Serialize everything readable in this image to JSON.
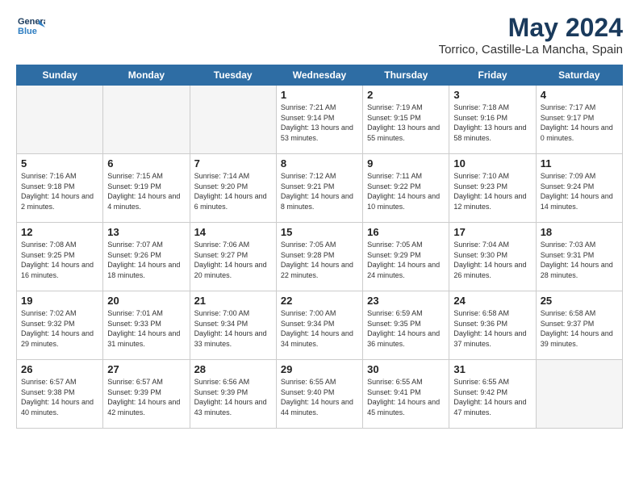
{
  "header": {
    "logo_line1": "General",
    "logo_line2": "Blue",
    "month": "May 2024",
    "location": "Torrico, Castille-La Mancha, Spain"
  },
  "weekdays": [
    "Sunday",
    "Monday",
    "Tuesday",
    "Wednesday",
    "Thursday",
    "Friday",
    "Saturday"
  ],
  "weeks": [
    [
      {
        "day": "",
        "empty": true
      },
      {
        "day": "",
        "empty": true
      },
      {
        "day": "",
        "empty": true
      },
      {
        "day": "1",
        "sunrise": "7:21 AM",
        "sunset": "9:14 PM",
        "daylight": "13 hours and 53 minutes."
      },
      {
        "day": "2",
        "sunrise": "7:19 AM",
        "sunset": "9:15 PM",
        "daylight": "13 hours and 55 minutes."
      },
      {
        "day": "3",
        "sunrise": "7:18 AM",
        "sunset": "9:16 PM",
        "daylight": "13 hours and 58 minutes."
      },
      {
        "day": "4",
        "sunrise": "7:17 AM",
        "sunset": "9:17 PM",
        "daylight": "14 hours and 0 minutes."
      }
    ],
    [
      {
        "day": "5",
        "sunrise": "7:16 AM",
        "sunset": "9:18 PM",
        "daylight": "14 hours and 2 minutes."
      },
      {
        "day": "6",
        "sunrise": "7:15 AM",
        "sunset": "9:19 PM",
        "daylight": "14 hours and 4 minutes."
      },
      {
        "day": "7",
        "sunrise": "7:14 AM",
        "sunset": "9:20 PM",
        "daylight": "14 hours and 6 minutes."
      },
      {
        "day": "8",
        "sunrise": "7:12 AM",
        "sunset": "9:21 PM",
        "daylight": "14 hours and 8 minutes."
      },
      {
        "day": "9",
        "sunrise": "7:11 AM",
        "sunset": "9:22 PM",
        "daylight": "14 hours and 10 minutes."
      },
      {
        "day": "10",
        "sunrise": "7:10 AM",
        "sunset": "9:23 PM",
        "daylight": "14 hours and 12 minutes."
      },
      {
        "day": "11",
        "sunrise": "7:09 AM",
        "sunset": "9:24 PM",
        "daylight": "14 hours and 14 minutes."
      }
    ],
    [
      {
        "day": "12",
        "sunrise": "7:08 AM",
        "sunset": "9:25 PM",
        "daylight": "14 hours and 16 minutes."
      },
      {
        "day": "13",
        "sunrise": "7:07 AM",
        "sunset": "9:26 PM",
        "daylight": "14 hours and 18 minutes."
      },
      {
        "day": "14",
        "sunrise": "7:06 AM",
        "sunset": "9:27 PM",
        "daylight": "14 hours and 20 minutes."
      },
      {
        "day": "15",
        "sunrise": "7:05 AM",
        "sunset": "9:28 PM",
        "daylight": "14 hours and 22 minutes."
      },
      {
        "day": "16",
        "sunrise": "7:05 AM",
        "sunset": "9:29 PM",
        "daylight": "14 hours and 24 minutes."
      },
      {
        "day": "17",
        "sunrise": "7:04 AM",
        "sunset": "9:30 PM",
        "daylight": "14 hours and 26 minutes."
      },
      {
        "day": "18",
        "sunrise": "7:03 AM",
        "sunset": "9:31 PM",
        "daylight": "14 hours and 28 minutes."
      }
    ],
    [
      {
        "day": "19",
        "sunrise": "7:02 AM",
        "sunset": "9:32 PM",
        "daylight": "14 hours and 29 minutes."
      },
      {
        "day": "20",
        "sunrise": "7:01 AM",
        "sunset": "9:33 PM",
        "daylight": "14 hours and 31 minutes."
      },
      {
        "day": "21",
        "sunrise": "7:00 AM",
        "sunset": "9:34 PM",
        "daylight": "14 hours and 33 minutes."
      },
      {
        "day": "22",
        "sunrise": "7:00 AM",
        "sunset": "9:34 PM",
        "daylight": "14 hours and 34 minutes."
      },
      {
        "day": "23",
        "sunrise": "6:59 AM",
        "sunset": "9:35 PM",
        "daylight": "14 hours and 36 minutes."
      },
      {
        "day": "24",
        "sunrise": "6:58 AM",
        "sunset": "9:36 PM",
        "daylight": "14 hours and 37 minutes."
      },
      {
        "day": "25",
        "sunrise": "6:58 AM",
        "sunset": "9:37 PM",
        "daylight": "14 hours and 39 minutes."
      }
    ],
    [
      {
        "day": "26",
        "sunrise": "6:57 AM",
        "sunset": "9:38 PM",
        "daylight": "14 hours and 40 minutes."
      },
      {
        "day": "27",
        "sunrise": "6:57 AM",
        "sunset": "9:39 PM",
        "daylight": "14 hours and 42 minutes."
      },
      {
        "day": "28",
        "sunrise": "6:56 AM",
        "sunset": "9:39 PM",
        "daylight": "14 hours and 43 minutes."
      },
      {
        "day": "29",
        "sunrise": "6:55 AM",
        "sunset": "9:40 PM",
        "daylight": "14 hours and 44 minutes."
      },
      {
        "day": "30",
        "sunrise": "6:55 AM",
        "sunset": "9:41 PM",
        "daylight": "14 hours and 45 minutes."
      },
      {
        "day": "31",
        "sunrise": "6:55 AM",
        "sunset": "9:42 PM",
        "daylight": "14 hours and 47 minutes."
      },
      {
        "day": "",
        "empty": true
      }
    ]
  ]
}
